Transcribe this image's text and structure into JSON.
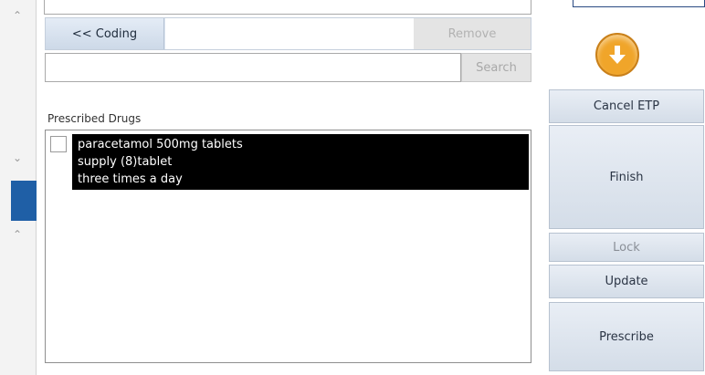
{
  "toolbar": {
    "coding_label": "<< Coding",
    "remove_label": "Remove",
    "search_label": "Search"
  },
  "search": {
    "value": "",
    "placeholder": ""
  },
  "prescribed": {
    "label": "Prescribed Drugs",
    "items": [
      {
        "lines": [
          "paracetamol 500mg tablets",
          "supply (8)tablet",
          "three times a day"
        ]
      }
    ]
  },
  "actions": {
    "cancel_etp": "Cancel ETP",
    "finish": "Finish",
    "lock": "Lock",
    "update": "Update",
    "prescribe": "Prescribe"
  },
  "icons": {
    "scroll_up": "chevron-up-icon",
    "scroll_down": "chevron-down-icon",
    "next_step": "arrow-down-circle-icon"
  },
  "colors": {
    "accent_blue": "#1f5fa6",
    "arrow_orange": "#f0a52a",
    "selection_black": "#000000"
  }
}
